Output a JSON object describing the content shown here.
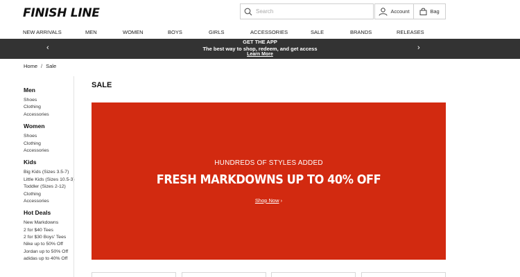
{
  "header": {
    "logo": "FINISH LINE",
    "search_placeholder": "Search",
    "account_label": "Account",
    "bag_label": "Bag"
  },
  "nav": {
    "items": [
      "NEW ARRIVALS",
      "MEN",
      "WOMEN",
      "BOYS",
      "GIRLS",
      "ACCESSORIES",
      "SALE",
      "BRANDS",
      "RELEASES"
    ]
  },
  "promo": {
    "title": "GET THE APP",
    "text": "The best way to shop, redeem, and get access",
    "link": "Learn More",
    "prev_icon": "chevron-left-icon",
    "next_icon": "chevron-right-icon"
  },
  "breadcrumb": {
    "home": "Home",
    "separator": "/",
    "current": "Sale"
  },
  "sidebar": {
    "groups": [
      {
        "title": "Men",
        "items": [
          "Shoes",
          "Clothing",
          "Accessories"
        ]
      },
      {
        "title": "Women",
        "items": [
          "Shoes",
          "Clothing",
          "Accessories"
        ]
      },
      {
        "title": "Kids",
        "items": [
          "Big Kids (Sizes 3.5-7)",
          "Little Kids (Sizes 10.5-3)",
          "Toddler (Sizes 2-12)",
          "Clothing",
          "Accessories"
        ]
      },
      {
        "title": "Hot Deals",
        "items": [
          "New Markdowns",
          "2 for $40 Tees",
          "2 for $30 Boys' Tees",
          "Nike up to 50% Off",
          "Jordan up to 50% Off",
          "adidas up to 40% Off"
        ]
      }
    ]
  },
  "main": {
    "title": "SALE",
    "hero": {
      "subtitle": "HUNDREDS OF STYLES ADDED",
      "headline": "FRESH MARKDOWNS UP TO 40% OFF",
      "cta": "Shop Now",
      "cta_arrow": "›",
      "background": "#d22a10"
    }
  },
  "colors": {
    "promo_bar": "#333333",
    "hero": "#d22a10"
  }
}
